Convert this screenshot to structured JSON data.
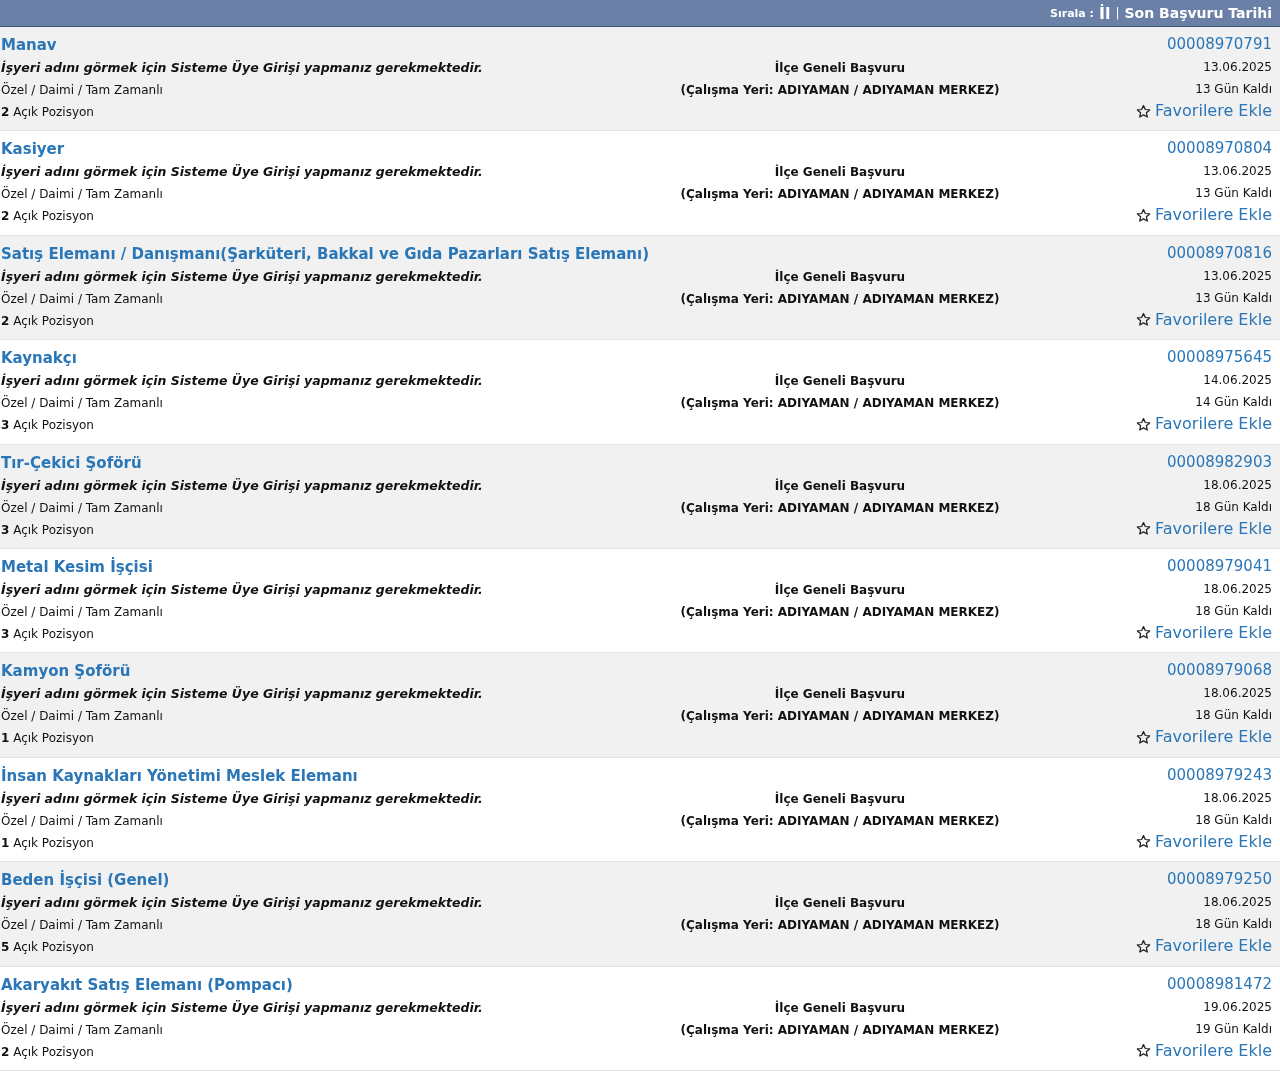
{
  "sort_bar": {
    "label": "Sırala :",
    "options": [
      "İl",
      "Son Başvuru Tarihi"
    ],
    "separator": "|"
  },
  "jobs": [
    {
      "title": "Manav",
      "employer_note": "İşyeri adını görmek için Sisteme Üye Girişi yapmanız gerekmektedir.",
      "type": "Özel / Daimi / Tam Zamanlı",
      "positions": "**2** Açık Pozisyon",
      "scope": "İlçe Geneli Başvuru",
      "location": "(Çalışma Yeri: ADIYAMAN / ADIYAMAN MERKEZ)",
      "number": "00008970791",
      "deadline": "13.06.2025",
      "remaining": "13 Gün Kaldı",
      "favorite": "Favorilere Ekle"
    },
    {
      "title": "Kasiyer",
      "employer_note": "İşyeri adını görmek için Sisteme Üye Girişi yapmanız gerekmektedir.",
      "type": "Özel / Daimi / Tam Zamanlı",
      "positions": "**2** Açık Pozisyon",
      "scope": "İlçe Geneli Başvuru",
      "location": "(Çalışma Yeri: ADIYAMAN / ADIYAMAN MERKEZ)",
      "number": "00008970804",
      "deadline": "13.06.2025",
      "remaining": "13 Gün Kaldı",
      "favorite": "Favorilere Ekle"
    },
    {
      "title": "Satış Elemanı / Danışmanı(Şarküteri, Bakkal ve Gıda Pazarları Satış Elemanı)",
      "employer_note": "İşyeri adını görmek için Sisteme Üye Girişi yapmanız gerekmektedir.",
      "type": "Özel / Daimi / Tam Zamanlı",
      "positions": "**2** Açık Pozisyon",
      "scope": "İlçe Geneli Başvuru",
      "location": "(Çalışma Yeri: ADIYAMAN / ADIYAMAN MERKEZ)",
      "number": "00008970816",
      "deadline": "13.06.2025",
      "remaining": "13 Gün Kaldı",
      "favorite": "Favorilere Ekle"
    },
    {
      "title": "Kaynakçı",
      "employer_note": "İşyeri adını görmek için Sisteme Üye Girişi yapmanız gerekmektedir.",
      "type": "Özel / Daimi / Tam Zamanlı",
      "positions": "**3** Açık Pozisyon",
      "scope": "İlçe Geneli Başvuru",
      "location": "(Çalışma Yeri: ADIYAMAN / ADIYAMAN MERKEZ)",
      "number": "00008975645",
      "deadline": "14.06.2025",
      "remaining": "14 Gün Kaldı",
      "favorite": "Favorilere Ekle"
    },
    {
      "title": "Tır-Çekici Şoförü",
      "employer_note": "İşyeri adını görmek için Sisteme Üye Girişi yapmanız gerekmektedir.",
      "type": "Özel / Daimi / Tam Zamanlı",
      "positions": "**3** Açık Pozisyon",
      "scope": "İlçe Geneli Başvuru",
      "location": "(Çalışma Yeri: ADIYAMAN / ADIYAMAN MERKEZ)",
      "number": "00008982903",
      "deadline": "18.06.2025",
      "remaining": "18 Gün Kaldı",
      "favorite": "Favorilere Ekle"
    },
    {
      "title": "Metal Kesim İşçisi",
      "employer_note": "İşyeri adını görmek için Sisteme Üye Girişi yapmanız gerekmektedir.",
      "type": "Özel / Daimi / Tam Zamanlı",
      "positions": "**3** Açık Pozisyon",
      "scope": "İlçe Geneli Başvuru",
      "location": "(Çalışma Yeri: ADIYAMAN / ADIYAMAN MERKEZ)",
      "number": "00008979041",
      "deadline": "18.06.2025",
      "remaining": "18 Gün Kaldı",
      "favorite": "Favorilere Ekle"
    },
    {
      "title": "Kamyon Şoförü",
      "employer_note": "İşyeri adını görmek için Sisteme Üye Girişi yapmanız gerekmektedir.",
      "type": "Özel / Daimi / Tam Zamanlı",
      "positions": "**1** Açık Pozisyon",
      "scope": "İlçe Geneli Başvuru",
      "location": "(Çalışma Yeri: ADIYAMAN / ADIYAMAN MERKEZ)",
      "number": "00008979068",
      "deadline": "18.06.2025",
      "remaining": "18 Gün Kaldı",
      "favorite": "Favorilere Ekle"
    },
    {
      "title": "İnsan Kaynakları Yönetimi Meslek Elemanı",
      "employer_note": "İşyeri adını görmek için Sisteme Üye Girişi yapmanız gerekmektedir.",
      "type": "Özel / Daimi / Tam Zamanlı",
      "positions": "**1** Açık Pozisyon",
      "scope": "İlçe Geneli Başvuru",
      "location": "(Çalışma Yeri: ADIYAMAN / ADIYAMAN MERKEZ)",
      "number": "00008979243",
      "deadline": "18.06.2025",
      "remaining": "18 Gün Kaldı",
      "favorite": "Favorilere Ekle"
    },
    {
      "title": "Beden İşçisi (Genel)",
      "employer_note": "İşyeri adını görmek için Sisteme Üye Girişi yapmanız gerekmektedir.",
      "type": "Özel / Daimi / Tam Zamanlı",
      "positions": "**5** Açık Pozisyon",
      "scope": "İlçe Geneli Başvuru",
      "location": "(Çalışma Yeri: ADIYAMAN / ADIYAMAN MERKEZ)",
      "number": "00008979250",
      "deadline": "18.06.2025",
      "remaining": "18 Gün Kaldı",
      "favorite": "Favorilere Ekle"
    },
    {
      "title": "Akaryakıt Satış Elemanı (Pompacı)",
      "employer_note": "İşyeri adını görmek için Sisteme Üye Girişi yapmanız gerekmektedir.",
      "type": "Özel / Daimi / Tam Zamanlı",
      "positions": "**2** Açık Pozisyon",
      "scope": "İlçe Geneli Başvuru",
      "location": "(Çalışma Yeri: ADIYAMAN / ADIYAMAN MERKEZ)",
      "number": "00008981472",
      "deadline": "19.06.2025",
      "remaining": "19 Gün Kaldı",
      "favorite": "Favorilere Ekle"
    }
  ]
}
